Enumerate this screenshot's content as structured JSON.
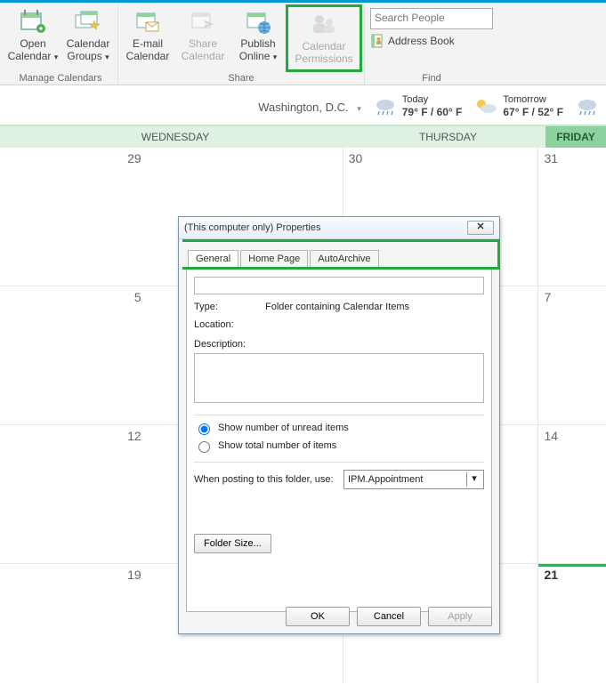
{
  "ribbon": {
    "open_calendar": "Open Calendar",
    "calendar_groups": "Calendar Groups",
    "manage_label": "Manage Calendars",
    "email_calendar": "E-mail Calendar",
    "share_calendar": "Share Calendar",
    "publish_online": "Publish Online",
    "calendar_permissions": "Calendar Permissions",
    "share_label": "Share",
    "search_placeholder": "Search People",
    "address_book": "Address Book",
    "find_label": "Find"
  },
  "weather": {
    "city": "Washington,  D.C.",
    "today_label": "Today",
    "today_temps": "79° F / 60° F",
    "tomorrow_label": "Tomorrow",
    "tomorrow_temps": "67° F / 52° F"
  },
  "days": {
    "wed": "WEDNESDAY",
    "thu": "THURSDAY",
    "fri": "FRIDAY"
  },
  "dates": {
    "r0": {
      "wed": "29",
      "thu": "30",
      "fri": "31"
    },
    "r1": {
      "wed": "5",
      "thu": "",
      "fri": "7"
    },
    "r2": {
      "wed": "12",
      "thu": "",
      "fri": "14"
    },
    "r3": {
      "wed": "19",
      "thu": "",
      "fri": "21"
    }
  },
  "dialog": {
    "title": "(This computer only) Properties",
    "tabs": {
      "general": "General",
      "homepage": "Home Page",
      "autoarchive": "AutoArchive"
    },
    "type_label": "Type:",
    "type_value": "Folder containing Calendar Items",
    "location_label": "Location:",
    "description_label": "Description:",
    "radio_unread": "Show number of unread items",
    "radio_total": "Show total number of items",
    "posting_label": "When posting to this folder, use:",
    "posting_value": "IPM.Appointment",
    "folder_size": "Folder Size...",
    "ok": "OK",
    "cancel": "Cancel",
    "apply": "Apply"
  }
}
